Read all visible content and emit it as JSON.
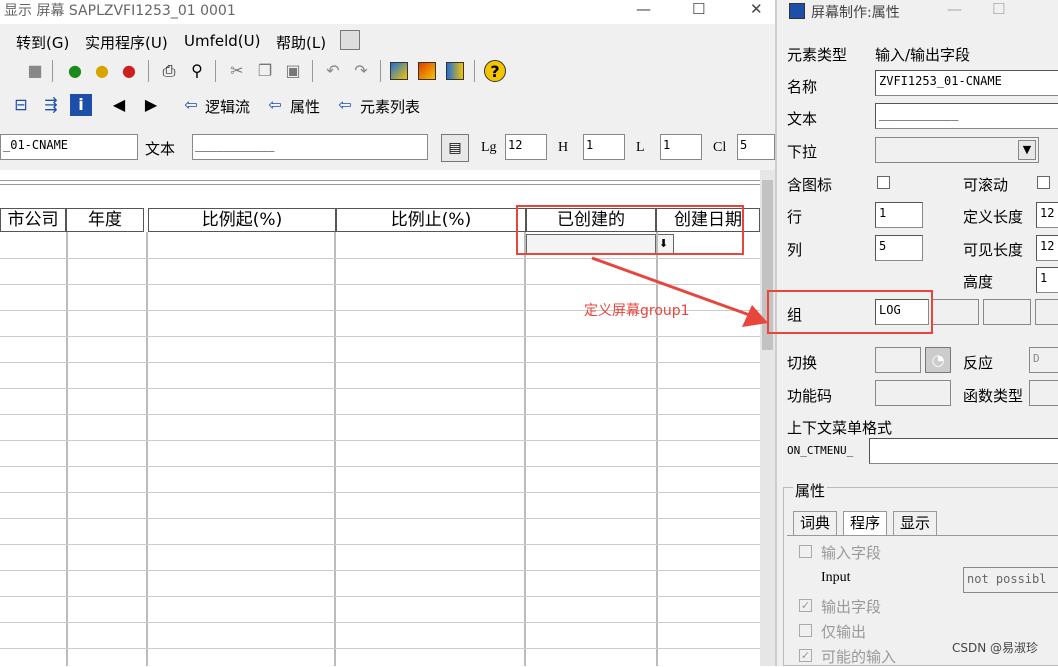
{
  "left_window": {
    "title": "显示 屏幕 SAPLZVFI1253_01 0001",
    "menu": [
      "转到(G)",
      "实用程序(U)",
      "Umfeld(U)",
      "帮助(L)"
    ],
    "toolbar2": {
      "logic_flow": "逻辑流",
      "attributes": "属性",
      "element_list": "元素列表"
    },
    "field_row": {
      "name_value": "_01-CNAME",
      "text_label": "文本",
      "text_value": "___________",
      "lg_label": "Lg",
      "lg_value": "12",
      "h_label": "H",
      "h_value": "1",
      "l_label": "L",
      "l_value": "1",
      "cl_label": "Cl",
      "cl_value": "5"
    },
    "table_headers": [
      "市公司",
      "年度",
      "比例起(%)",
      "比例止(%)",
      "已创建的",
      "创建日期"
    ]
  },
  "annotation": {
    "text": "定义屏幕group1",
    "color": "#e8453c"
  },
  "right_window": {
    "title": "屏幕制作:属性",
    "element_type_label": "元素类型",
    "element_type_value": "输入/输出字段",
    "name_label": "名称",
    "name_value": "ZVFI1253_01-CNAME",
    "text_label": "文本",
    "text_value": "___________",
    "dropdown_label": "下拉",
    "icon_label": "含图标",
    "scroll_label": "可滚动",
    "row_label": "行",
    "row_value": "1",
    "def_length_label": "定义长度",
    "def_length_value": "12",
    "col_label": "列",
    "col_value": "5",
    "vis_length_label": "可见长度",
    "vis_length_value": "12",
    "height_label": "高度",
    "height_value": "1",
    "group_label": "组",
    "group_value": "LOG",
    "switch_label": "切换",
    "response_label": "反应",
    "response_value": "D",
    "fcode_label": "功能码",
    "ftype_label": "函数类型",
    "context_menu_label": "上下文菜单格式",
    "context_menu_value": "ON_CTMENU_",
    "attributes_group": "属性",
    "tabs": [
      "词典",
      "程序",
      "显示"
    ],
    "input_field_label": "输入字段",
    "input_label": "Input",
    "input_select_value": "not possibl",
    "output_field_label": "输出字段",
    "output_only_label": "仅输出",
    "possible_input_label": "可能的输入"
  },
  "watermark": "CSDN @易淑珍"
}
